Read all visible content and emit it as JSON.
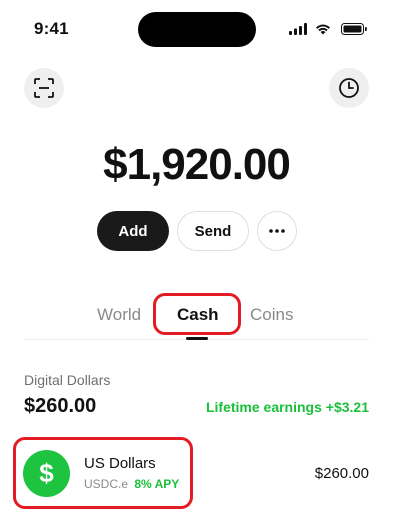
{
  "status_bar": {
    "time": "9:41"
  },
  "top_buttons": {
    "scan_icon": "scan-icon",
    "history_icon": "clock-icon"
  },
  "balance": "$1,920.00",
  "actions": {
    "add_label": "Add",
    "send_label": "Send",
    "more_icon": "more-dots-icon"
  },
  "tabs": [
    {
      "label": "World",
      "active": false
    },
    {
      "label": "Cash",
      "active": true
    },
    {
      "label": "Coins",
      "active": false
    }
  ],
  "section": {
    "label": "Digital Dollars",
    "amount": "$260.00",
    "earnings": "Lifetime earnings +$3.21"
  },
  "assets": [
    {
      "name": "US Dollars",
      "ticker": "USDC.e",
      "apy": "8% APY",
      "amount": "$260.00",
      "icon": "dollar-icon",
      "icon_symbol": "$"
    }
  ],
  "colors": {
    "accent_green": "#1bbf3a",
    "icon_green": "#1ec33f",
    "highlight_red": "#e31b23",
    "primary_dark": "#1a1a1a"
  }
}
